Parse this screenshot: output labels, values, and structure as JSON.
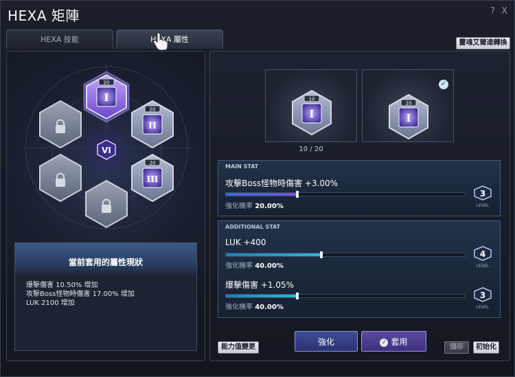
{
  "window": {
    "title": "HEXA 矩陣",
    "help_label": "?",
    "close_label": "X"
  },
  "tabs": [
    {
      "label": "HEXA 技能",
      "active": false
    },
    {
      "label": "HEXA 屬性",
      "active": true
    }
  ],
  "top_button_label": "靈魂艾爾達轉換",
  "hex_grid": {
    "center_symbol": "VI",
    "nodes": [
      {
        "symbol": "I",
        "level_badge": "20",
        "locked": false,
        "selected": true
      },
      {
        "symbol": "II",
        "level_badge": "20",
        "locked": false,
        "selected": false
      },
      {
        "symbol": "III",
        "level_badge": "20",
        "locked": false,
        "selected": false
      },
      {
        "symbol": "",
        "level_badge": "",
        "locked": true
      },
      {
        "symbol": "",
        "level_badge": "",
        "locked": true
      },
      {
        "symbol": "",
        "level_badge": "",
        "locked": true
      }
    ]
  },
  "status_box": {
    "title": "當前套用的屬性現狀",
    "lines": [
      "爆擊傷害 10.50% 增加",
      "攻擊Boss怪物時傷害 17.00% 增加",
      "LUK 2100 增加"
    ]
  },
  "preview": {
    "card_one": {
      "badge": "10",
      "symbol": "I",
      "level_text": "10 / 20"
    },
    "card_two": {
      "badge": "20",
      "symbol": "I",
      "selected": true
    }
  },
  "main_stat": {
    "tag": "MAIN STAT",
    "name": "攻擊Boss怪物時傷害 +3.00%",
    "progress": 0.3,
    "rate_label": "強化機率",
    "rate_value": "20.00%",
    "level": "3",
    "level_word": "LEVEL"
  },
  "additional_stat": {
    "tag": "ADDITIONAL STAT",
    "stats": [
      {
        "name": "LUK +400",
        "progress": 0.4,
        "rate_label": "強化機率",
        "rate_value": "40.00%",
        "level": "4",
        "level_word": "LEVEL"
      },
      {
        "name": "爆擊傷害 +1.05%",
        "progress": 0.3,
        "rate_label": "強化機率",
        "rate_value": "40.00%",
        "level": "3",
        "level_word": "LEVEL"
      }
    ]
  },
  "buttons": {
    "stat_change": "能力值變更",
    "enhance": "強化",
    "apply": "套用",
    "save": "儲存",
    "reset": "初始化"
  },
  "colors": {
    "accent_purple": "#7a52d9",
    "bar_blue": "#2e88d6",
    "bar_cyan": "#2ab7d9",
    "panel_border": "#3f5a7a"
  }
}
